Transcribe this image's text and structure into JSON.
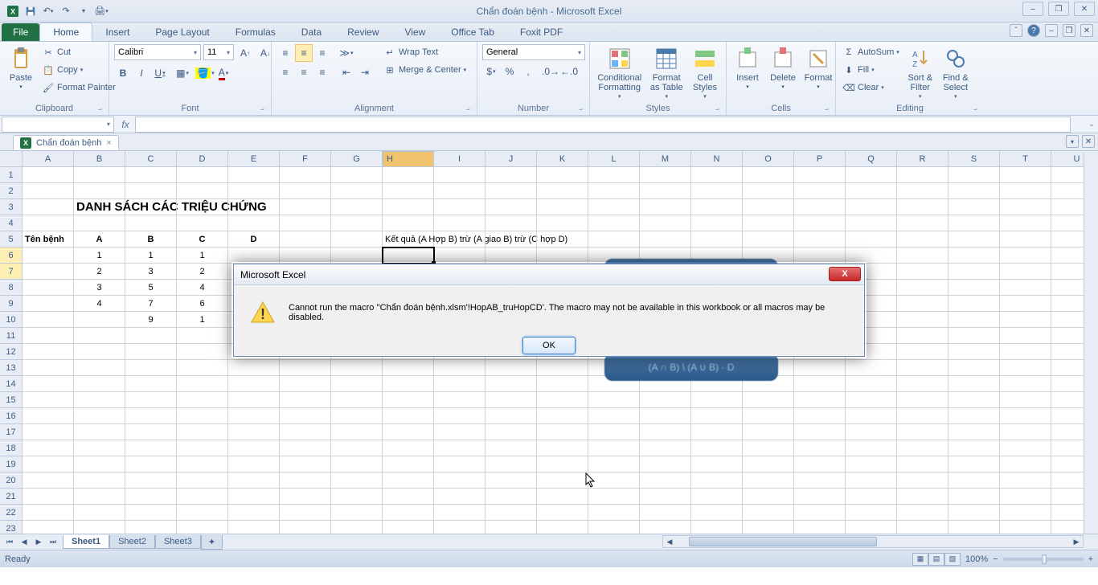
{
  "title": "Chẩn đoán bệnh - Microsoft Excel",
  "qat": {
    "save": "💾",
    "undo": "↶",
    "redo": "↷"
  },
  "tabs": {
    "file": "File",
    "items": [
      "Home",
      "Insert",
      "Page Layout",
      "Formulas",
      "Data",
      "Review",
      "View",
      "Office Tab",
      "Foxit PDF"
    ],
    "active": "Home"
  },
  "ribbon": {
    "clipboard": {
      "label": "Clipboard",
      "paste": "Paste",
      "cut": "Cut",
      "copy": "Copy",
      "fp": "Format Painter"
    },
    "font": {
      "label": "Font",
      "name": "Calibri",
      "size": "11",
      "bold": "B",
      "italic": "I",
      "underline": "U"
    },
    "alignment": {
      "label": "Alignment",
      "wrap": "Wrap Text",
      "merge": "Merge & Center"
    },
    "number": {
      "label": "Number",
      "format": "General"
    },
    "styles": {
      "label": "Styles",
      "cf": "Conditional\nFormatting",
      "fat": "Format\nas Table",
      "cs": "Cell\nStyles"
    },
    "cells": {
      "label": "Cells",
      "insert": "Insert",
      "delete": "Delete",
      "format": "Format"
    },
    "editing": {
      "label": "Editing",
      "autosum": "AutoSum",
      "fill": "Fill",
      "clear": "Clear",
      "sort": "Sort &\nFilter",
      "find": "Find &\nSelect"
    }
  },
  "formula": {
    "namebox": "",
    "fx": "fx"
  },
  "doctab": {
    "name": "Chẩn đoán bệnh",
    "close": "×"
  },
  "columns": [
    "A",
    "B",
    "C",
    "D",
    "E",
    "F",
    "G",
    "H",
    "I",
    "J",
    "K",
    "L",
    "M",
    "N",
    "O",
    "P",
    "Q",
    "R",
    "S",
    "T",
    "U"
  ],
  "selected_col": "H",
  "sheet": {
    "title_cell": "DANH SÁCH CÁC TRIỆU CHỨNG",
    "headers": {
      "ten": "Tên bệnh",
      "A": "A",
      "B": "B",
      "C": "C",
      "D": "D"
    },
    "ketqua": "Kết quả (A Hợp B) trừ (A giao B) trừ (C hợp D)",
    "rows": [
      {
        "A": "1",
        "B": "1",
        "C": "1",
        "D": ""
      },
      {
        "A": "2",
        "B": "3",
        "C": "2",
        "D": ""
      },
      {
        "A": "3",
        "B": "5",
        "C": "4",
        "D": ""
      },
      {
        "A": "4",
        "B": "7",
        "C": "6",
        "D": ""
      },
      {
        "A": "",
        "B": "9",
        "C": "1",
        "D": ""
      }
    ]
  },
  "dialog": {
    "title": "Microsoft Excel",
    "text": "Cannot run the macro ''Chẩn đoán bệnh.xlsm'!HopAB_truHopCD'. The macro may not be available in this workbook or all macros may be disabled.",
    "ok": "OK",
    "close": "X"
  },
  "sheets": {
    "nav": [
      "⏮",
      "◀",
      "▶",
      "⏭"
    ],
    "items": [
      "Sheet1",
      "Sheet2",
      "Sheet3"
    ],
    "active": "Sheet1"
  },
  "status": {
    "ready": "Ready",
    "zoom": "100%",
    "minus": "−",
    "plus": "+"
  },
  "win": {
    "min": "–",
    "max": "❐",
    "close": "✕"
  }
}
